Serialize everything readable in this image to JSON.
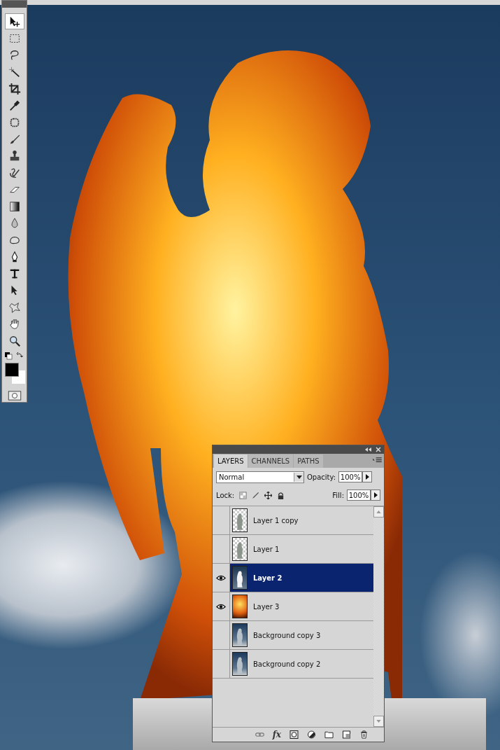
{
  "tools": [
    {
      "selected": true
    },
    {
      "selected": false
    },
    {
      "selected": false
    },
    {
      "selected": false
    },
    {
      "selected": false
    },
    {
      "selected": false
    },
    {
      "selected": false
    },
    {
      "selected": false
    },
    {
      "selected": false
    },
    {
      "selected": false
    },
    {
      "selected": false
    },
    {
      "selected": false
    },
    {
      "selected": false
    },
    {
      "selected": false
    },
    {
      "selected": false
    },
    {
      "selected": false
    },
    {
      "selected": false
    },
    {
      "selected": false
    },
    {
      "selected": false
    },
    {
      "selected": false
    }
  ],
  "layers_panel": {
    "tabs": [
      {
        "label": "LAYERS",
        "selected": true
      },
      {
        "label": "CHANNELS",
        "selected": false
      },
      {
        "label": "PATHS",
        "selected": false
      }
    ],
    "blend_mode": "Normal",
    "opacity_label": "Opacity:",
    "opacity": "100%",
    "lock_label": "Lock:",
    "fill_label": "Fill:",
    "fill": "100%",
    "layers": [
      {
        "name": "Layer 1 copy",
        "visible": false,
        "selected": false,
        "kind": "transparent"
      },
      {
        "name": "Layer 1",
        "visible": false,
        "selected": false,
        "kind": "transparent"
      },
      {
        "name": "Layer 2",
        "visible": true,
        "selected": true,
        "kind": "cutout"
      },
      {
        "name": "Layer 3",
        "visible": true,
        "selected": false,
        "kind": "fire"
      },
      {
        "name": "Background copy 3",
        "visible": false,
        "selected": false,
        "kind": "photo"
      },
      {
        "name": "Background copy 2",
        "visible": false,
        "selected": false,
        "kind": "photo"
      }
    ],
    "fx_label": "fx"
  }
}
